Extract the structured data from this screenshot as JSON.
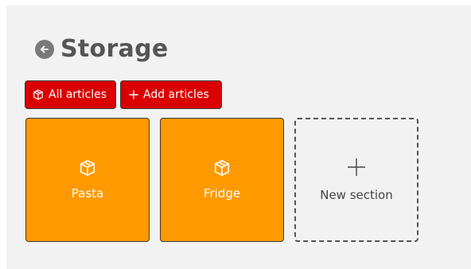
{
  "header": {
    "title": "Storage",
    "back_icon": "arrow-left-circle-icon"
  },
  "toolbar": {
    "all_articles_label": "All articles",
    "all_articles_icon": "box-icon",
    "add_articles_label": "Add articles",
    "add_articles_icon": "plus-icon"
  },
  "sections": [
    {
      "label": "Pasta",
      "icon": "box-icon"
    },
    {
      "label": "Fridge",
      "icon": "box-icon"
    }
  ],
  "new_section": {
    "label": "New section",
    "icon": "plus-icon"
  },
  "colors": {
    "button_red": "#db0000",
    "tile_orange": "#ff9900",
    "title_gray": "#555555",
    "panel_bg": "#f2f2f2"
  }
}
